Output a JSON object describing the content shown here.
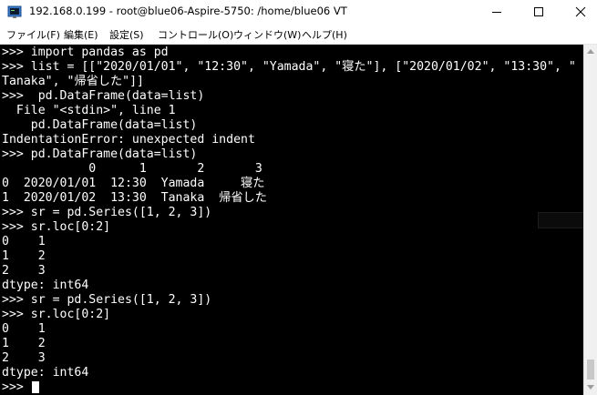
{
  "window": {
    "title": "192.168.0.199 - root@blue06-Aspire-5750: /home/blue06 VT"
  },
  "menu": {
    "items": [
      "ファイル(F)",
      "編集(E)",
      "設定(S)",
      "コントロール(O)",
      "ウィンドウ(W)",
      "ヘルプ(H)"
    ]
  },
  "terminal": {
    "lines": [
      ">>> import pandas as pd",
      ">>> list = [[\"2020/01/01\", \"12:30\", \"Yamada\", \"寝た\"], [\"2020/01/02\", \"13:30\", \"",
      "Tanaka\", \"帰省した\"]]",
      ">>>  pd.DataFrame(data=list)",
      "  File \"<stdin>\", line 1",
      "    pd.DataFrame(data=list)",
      "IndentationError: unexpected indent",
      ">>> pd.DataFrame(data=list)",
      "            0      1       2       3",
      "0  2020/01/01  12:30  Yamada     寝た",
      "1  2020/01/02  13:30  Tanaka  帰省した",
      ">>> sr = pd.Series([1, 2, 3])",
      ">>> sr.loc[0:2]",
      "0    1",
      "1    2",
      "2    3",
      "dtype: int64",
      ">>> sr = pd.Series([1, 2, 3])",
      ">>> sr.loc[0:2]",
      "0    1",
      "1    2",
      "2    3",
      "dtype: int64",
      ">>> "
    ]
  },
  "colors": {
    "terminal_bg": "#000000",
    "terminal_fg": "#ffffff",
    "titlebar_bg": "#ffffff"
  },
  "icons": {
    "app": "teraterm-icon",
    "minimize": "minimize-icon",
    "maximize": "maximize-icon",
    "close": "close-icon"
  }
}
